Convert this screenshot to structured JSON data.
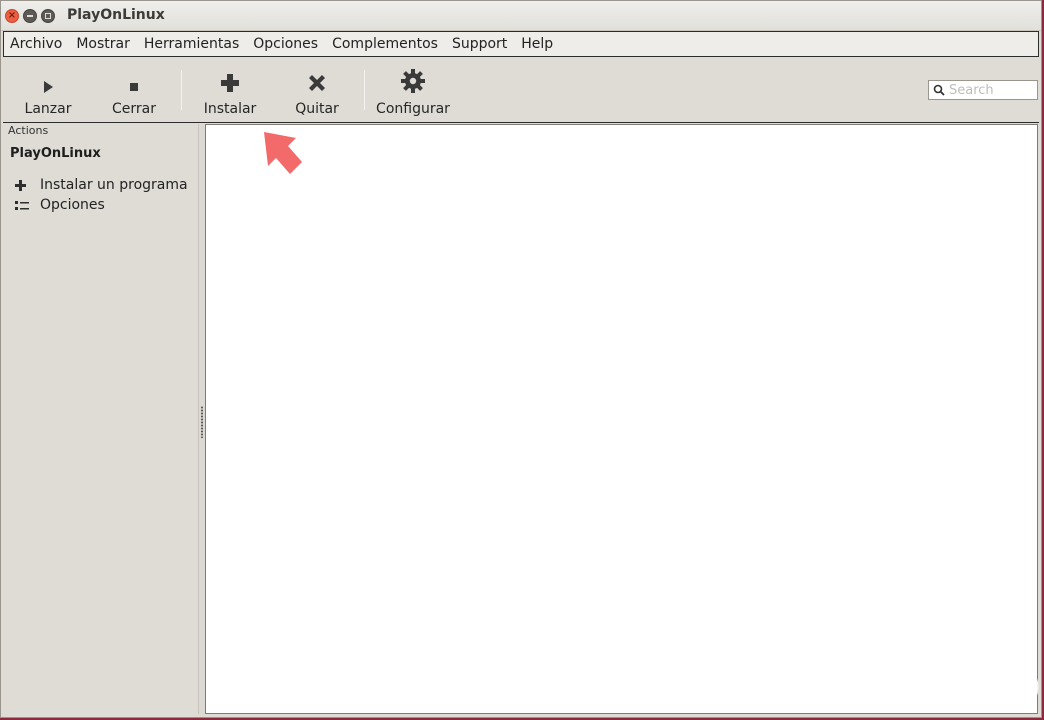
{
  "window": {
    "title": "PlayOnLinux"
  },
  "menu": [
    "Archivo",
    "Mostrar",
    "Herramientas",
    "Opciones",
    "Complementos",
    "Support",
    "Help"
  ],
  "toolbar": {
    "lanzar": "Lanzar",
    "cerrar": "Cerrar",
    "instalar": "Instalar",
    "quitar": "Quitar",
    "configurar": "Configurar"
  },
  "search": {
    "placeholder": "Search",
    "value": ""
  },
  "sidebar": {
    "header": "Actions",
    "section": "PlayOnLinux",
    "items": [
      {
        "label": "Instalar un programa",
        "icon": "plus-icon"
      },
      {
        "label": "Opciones",
        "icon": "options-list-icon"
      }
    ]
  },
  "colors": {
    "window_bg": "#dfdcd6",
    "content_bg": "#ffffff",
    "annotation_arrow": "#f26a6a",
    "close_button": "#ec5f42"
  }
}
